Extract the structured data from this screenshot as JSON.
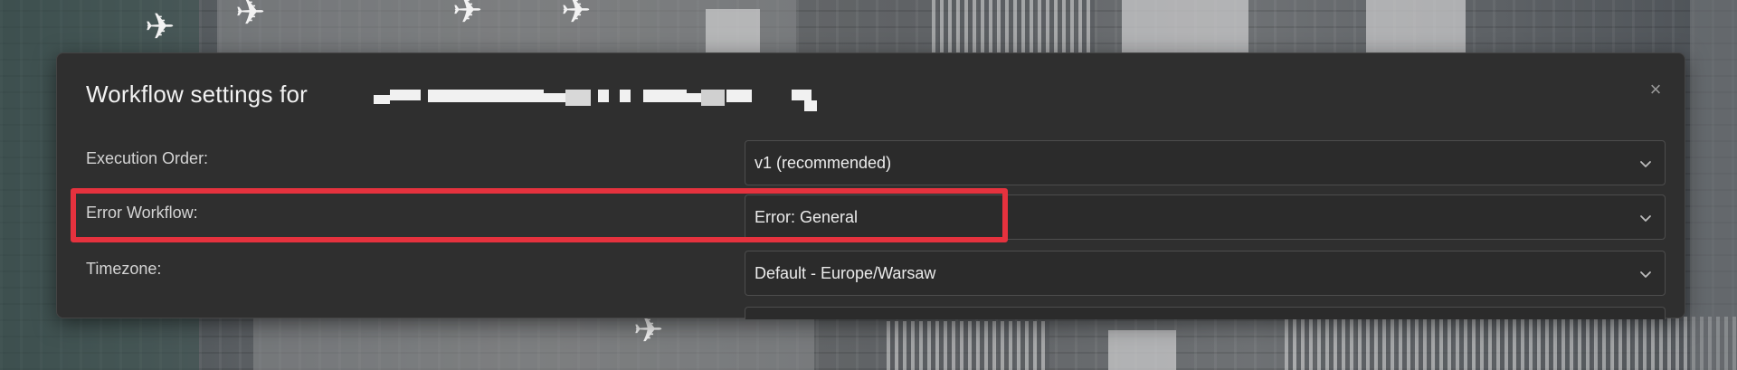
{
  "dialog": {
    "title": "Workflow settings for",
    "close_glyph": "×"
  },
  "settings": [
    {
      "label": "Execution Order:",
      "value": "v1 (recommended)"
    },
    {
      "label": "Error Workflow:",
      "value": "Error: General"
    },
    {
      "label": "Timezone:",
      "value": "Default - Europe/Warsaw"
    }
  ],
  "colors": {
    "dialog_bg": "#2f2f2f",
    "highlight": "#e5323e"
  },
  "icons": {
    "close": "close-icon",
    "dropdown": "chevron-down-icon"
  }
}
